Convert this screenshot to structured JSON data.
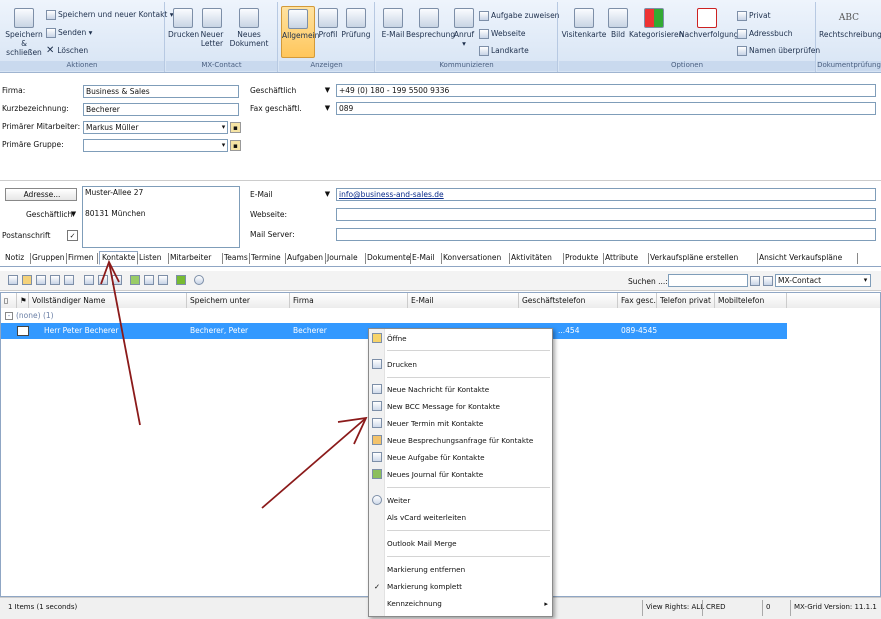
{
  "ribbon": {
    "groups": {
      "aktionen": "Aktionen",
      "mx_contact": "MX-Contact",
      "anzeigen": "Anzeigen",
      "kommunizieren": "Kommunizieren",
      "optionen": "Optionen",
      "dokumentpruefung": "Dokumentprüfung"
    },
    "save_close": "Speichern & schließen",
    "save_new": "Speichern und neuer Kontakt",
    "send": "Senden",
    "delete": "Löschen",
    "print": "Drucken",
    "new_letter": "Neuer Letter",
    "new_document": "Neues Dokument",
    "general": "Allgemein",
    "profile": "Profil",
    "review": "Prüfung",
    "email": "E-Mail",
    "meeting": "Besprechung",
    "call": "Anruf",
    "assign_task": "Aufgabe zuweisen",
    "webpage": "Webseite",
    "map": "Landkarte",
    "business_card": "Visitenkarte",
    "picture": "Bild",
    "categorize": "Kategorisieren",
    "follow_up": "Nachverfolgung",
    "private": "Privat",
    "address_book": "Adressbuch",
    "check_names": "Namen überprüfen",
    "spelling": "Rechtschreibung",
    "abc": "ABC"
  },
  "form": {
    "firma_label": "Firma:",
    "firma_value": "Business & Sales",
    "kurz_label": "Kurzbezeichnung:",
    "kurz_value": "Becherer",
    "mitarbeiter_label": "Primärer Mitarbeiter:",
    "mitarbeiter_value": "Markus Müller",
    "gruppe_label": "Primäre Gruppe:",
    "gruppe_value": "",
    "phone_label": "Geschäftlich",
    "phone_value": "+49 (0) 180 - 199 5500 9336",
    "fax_label": "Fax geschäftl.",
    "fax_value": "089",
    "address_button": "Adresse...",
    "address_type": "Geschäftlich",
    "postal_label": "Postanschrift",
    "postal_checked": "✓",
    "street": "Muster-Allee 27",
    "city": "80131 München",
    "email_label": "E-Mail",
    "email_value": "info@business-and-sales.de",
    "web_label": "Webseite:",
    "web_value": "",
    "mail_server_label": "Mail Server:",
    "mail_server_value": ""
  },
  "tabs": [
    "Notiz",
    "Gruppen",
    "Firmen",
    "Kontakte",
    "Listen",
    "Mitarbeiter",
    "Teams",
    "Termine",
    "Aufgaben",
    "Journale",
    "Dokumente",
    "E-Mail",
    "Konversationen",
    "Aktivitäten",
    "Produkte",
    "Attribute",
    "Verkaufspläne erstellen",
    "Ansicht Verkaufspläne"
  ],
  "search": {
    "label": "Suchen ...:",
    "scope": "MX-Contact"
  },
  "grid": {
    "columns": [
      "Vollständiger Name",
      "Speichern unter",
      "Firma",
      "E-Mail",
      "Geschäftstelefon",
      "Fax gesc...",
      "Telefon privat",
      "Mobiltelefon"
    ],
    "group_label": "(none) (1)",
    "row": {
      "name": "Herr Peter Becherer",
      "save_as": "Becherer, Peter",
      "company": "Becherer",
      "phone": "089-4545...",
      "phone_partial": "...454",
      "fax": "089-4545..."
    }
  },
  "context_menu": {
    "open": "Öffne",
    "print": "Drucken",
    "new_message": "Neue Nachricht für Kontakte",
    "new_bcc": "New BCC Message for Kontakte",
    "new_appointment": "Neuer Termin mit Kontakte",
    "new_meeting": "Neue Besprechungsanfrage für Kontakte",
    "new_task": "Neue Aufgabe für Kontakte",
    "new_journal": "Neues Journal für Kontakte",
    "forward": "Weiter",
    "vcard": "Als vCard weiterleiten",
    "mail_merge": "Outlook Mail Merge",
    "remove_flag": "Markierung entfernen",
    "flag_complete": "Markierung komplett",
    "mark": "Kennzeichnung",
    "check": "✓",
    "arrow": "▸"
  },
  "status": {
    "items": "1 Items (1 seconds)",
    "view_rights": "View Rights: ALL",
    "cred": "CRED",
    "count": "0",
    "version": "MX-Grid Version: 11.1.1"
  },
  "colors": {
    "accent": "#3399ff",
    "selection": "#3399ff",
    "arrow": "#8b1a1a"
  }
}
